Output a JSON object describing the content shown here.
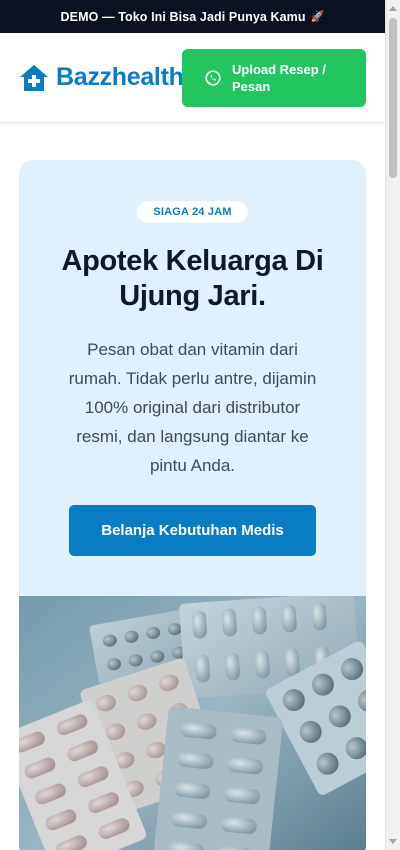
{
  "demo_bar": {
    "text": "DEMO — Toko Ini Bisa Jadi Punya Kamu",
    "emoji": "🚀"
  },
  "header": {
    "logo_text": "Bazzhealth",
    "logo_icon": "house-plus-icon",
    "upload_button": {
      "label": "Upload Resep / Pesan",
      "icon": "whatsapp-icon"
    }
  },
  "hero": {
    "badge": "SIAGA 24 JAM",
    "title": "Apotek Keluarga Di Ujung Jari.",
    "description": "Pesan obat dan vitamin dari rumah. Tidak perlu antre, dijamin 100% original dari distributor resmi, dan langsung diantar ke pintu Anda.",
    "cta_label": "Belanja Kebutuhan Medis",
    "image": "medicine-blister-packs-photo"
  },
  "colors": {
    "brand": "#0a7cc4",
    "whatsapp_green": "#22c55e",
    "demo_bar_bg": "#0b1120",
    "hero_bg": "#e0f1fd"
  }
}
